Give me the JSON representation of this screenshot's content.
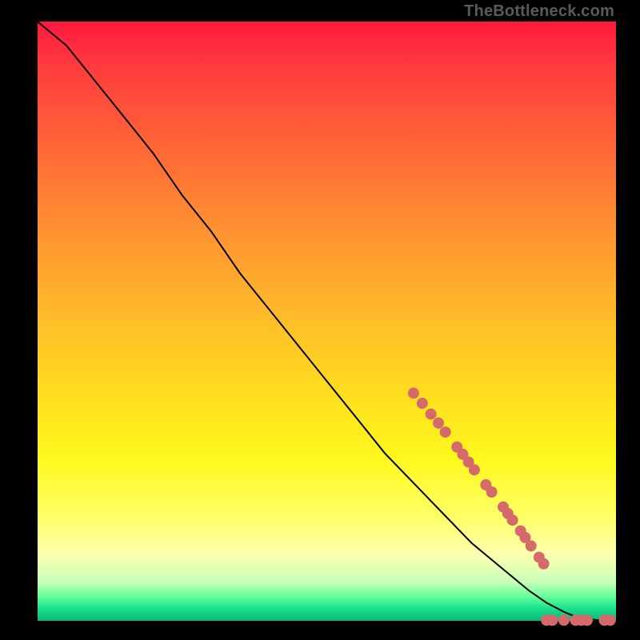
{
  "watermark": "TheBottleneck.com",
  "chart_data": {
    "type": "line",
    "title": "",
    "xlabel": "",
    "ylabel": "",
    "xlim": [
      0,
      100
    ],
    "ylim": [
      0,
      100
    ],
    "grid": false,
    "series": [
      {
        "name": "curve",
        "x": [
          0,
          5,
          10,
          15,
          20,
          25,
          30,
          35,
          40,
          45,
          50,
          55,
          60,
          65,
          70,
          75,
          80,
          85,
          88,
          91,
          93,
          95,
          97,
          99,
          100
        ],
        "y": [
          100,
          96,
          90,
          84,
          78,
          71,
          65,
          58,
          52,
          46,
          40,
          34,
          28,
          23,
          18,
          13,
          9,
          5,
          3,
          1.5,
          0.7,
          0.3,
          0.1,
          0.05,
          0.05
        ]
      }
    ],
    "markers": [
      {
        "x": 65.0,
        "y": 38.0
      },
      {
        "x": 66.5,
        "y": 36.3
      },
      {
        "x": 68.0,
        "y": 34.5
      },
      {
        "x": 69.3,
        "y": 33.0
      },
      {
        "x": 70.5,
        "y": 31.5
      },
      {
        "x": 72.5,
        "y": 29.0
      },
      {
        "x": 73.5,
        "y": 27.8
      },
      {
        "x": 74.5,
        "y": 26.5
      },
      {
        "x": 75.5,
        "y": 25.2
      },
      {
        "x": 77.5,
        "y": 22.7
      },
      {
        "x": 78.5,
        "y": 21.5
      },
      {
        "x": 80.5,
        "y": 19.0
      },
      {
        "x": 81.3,
        "y": 17.9
      },
      {
        "x": 82.1,
        "y": 16.8
      },
      {
        "x": 83.5,
        "y": 15.0
      },
      {
        "x": 84.3,
        "y": 13.9
      },
      {
        "x": 85.3,
        "y": 12.5
      },
      {
        "x": 86.7,
        "y": 10.6
      },
      {
        "x": 87.5,
        "y": 9.5
      },
      {
        "x": 88.0,
        "y": 0.1
      },
      {
        "x": 89.0,
        "y": 0.1
      },
      {
        "x": 91.0,
        "y": 0.1
      },
      {
        "x": 93.0,
        "y": 0.1
      },
      {
        "x": 94.0,
        "y": 0.1
      },
      {
        "x": 95.0,
        "y": 0.1
      },
      {
        "x": 98.0,
        "y": 0.1
      },
      {
        "x": 99.0,
        "y": 0.1
      }
    ],
    "colors": {
      "curve_stroke": "#000000",
      "marker_fill": "#d46a6a"
    }
  }
}
